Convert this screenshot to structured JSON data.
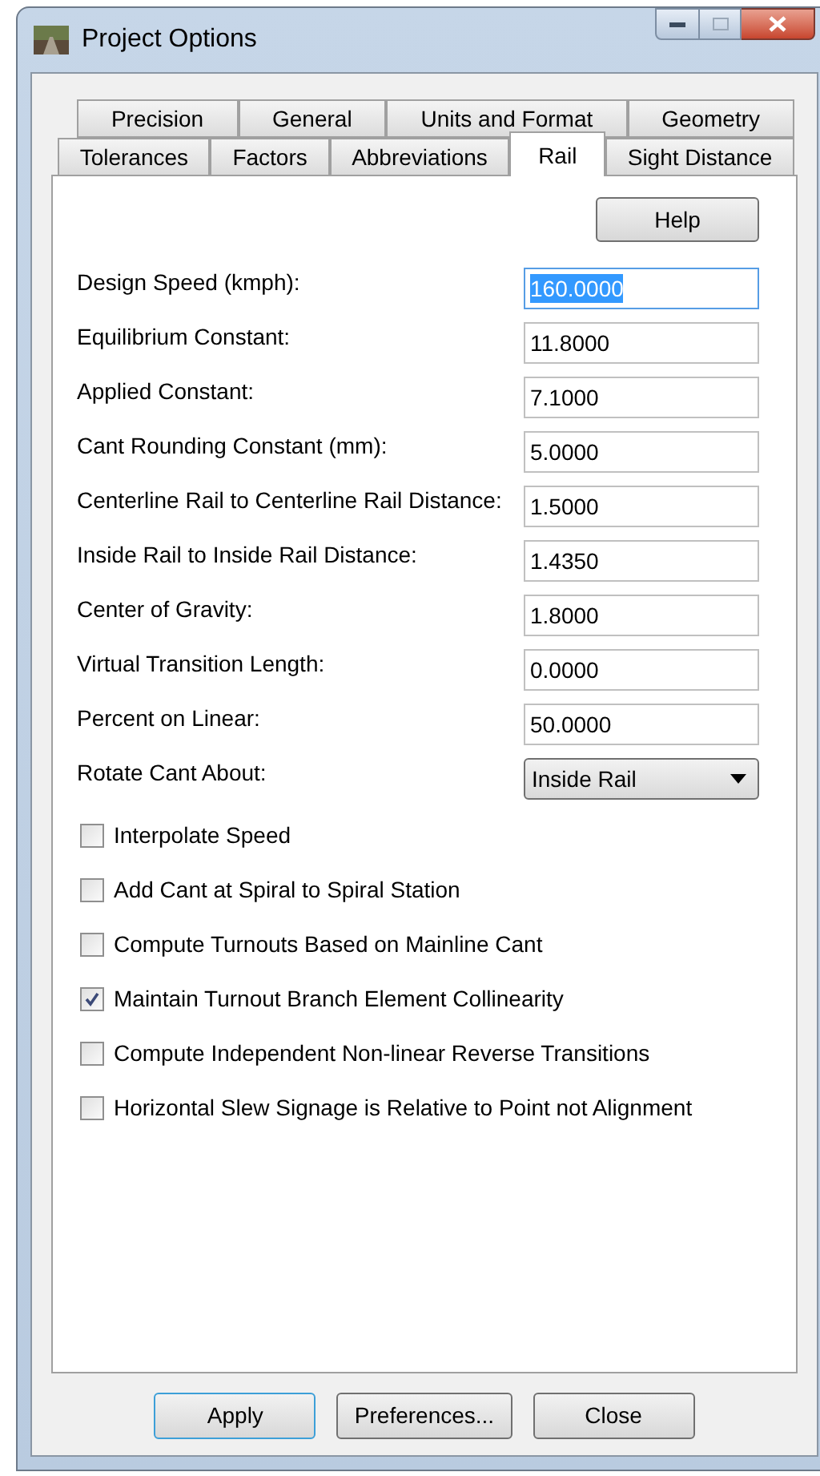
{
  "window": {
    "title": "Project Options"
  },
  "tab_rows": [
    [
      {
        "label": "Precision",
        "selected": false
      },
      {
        "label": "General",
        "selected": false
      },
      {
        "label": "Units and Format",
        "selected": false
      },
      {
        "label": "Geometry",
        "selected": false
      }
    ],
    [
      {
        "label": "Tolerances",
        "selected": false
      },
      {
        "label": "Factors",
        "selected": false
      },
      {
        "label": "Abbreviations",
        "selected": false
      },
      {
        "label": "Rail",
        "selected": true
      },
      {
        "label": "Sight Distance",
        "selected": false
      }
    ]
  ],
  "help_button": "Help",
  "fields": [
    {
      "kind": "text",
      "label": "Design Speed (kmph):",
      "value": "160.0000",
      "focused": true
    },
    {
      "kind": "text",
      "label": "Equilibrium Constant:",
      "value": "11.8000",
      "focused": false
    },
    {
      "kind": "text",
      "label": "Applied Constant:",
      "value": "7.1000",
      "focused": false
    },
    {
      "kind": "text",
      "label": "Cant Rounding Constant (mm):",
      "value": "5.0000",
      "focused": false
    },
    {
      "kind": "text",
      "label": "Centerline Rail to Centerline Rail Distance:",
      "value": "1.5000",
      "focused": false
    },
    {
      "kind": "text",
      "label": "Inside Rail to Inside Rail Distance:",
      "value": "1.4350",
      "focused": false
    },
    {
      "kind": "text",
      "label": "Center of Gravity:",
      "value": "1.8000",
      "focused": false
    },
    {
      "kind": "text",
      "label": "Virtual Transition Length:",
      "value": "0.0000",
      "focused": false
    },
    {
      "kind": "text",
      "label": "Percent on Linear:",
      "value": "50.0000",
      "focused": false
    },
    {
      "kind": "dropdown",
      "label": "Rotate Cant About:",
      "value": "Inside Rail",
      "focused": false
    }
  ],
  "checkboxes": [
    {
      "label": "Interpolate Speed",
      "checked": false
    },
    {
      "label": "Add Cant at Spiral to Spiral Station",
      "checked": false
    },
    {
      "label": "Compute Turnouts Based on Mainline Cant",
      "checked": false
    },
    {
      "label": "Maintain Turnout Branch Element Collinearity",
      "checked": true
    },
    {
      "label": "Compute Independent Non-linear Reverse Transitions",
      "checked": false
    },
    {
      "label": "Horizontal Slew Signage is Relative to Point not Alignment",
      "checked": false
    }
  ],
  "buttons": [
    {
      "label": "Apply",
      "default": true
    },
    {
      "label": "Preferences...",
      "default": false
    },
    {
      "label": "Close",
      "default": false
    }
  ]
}
